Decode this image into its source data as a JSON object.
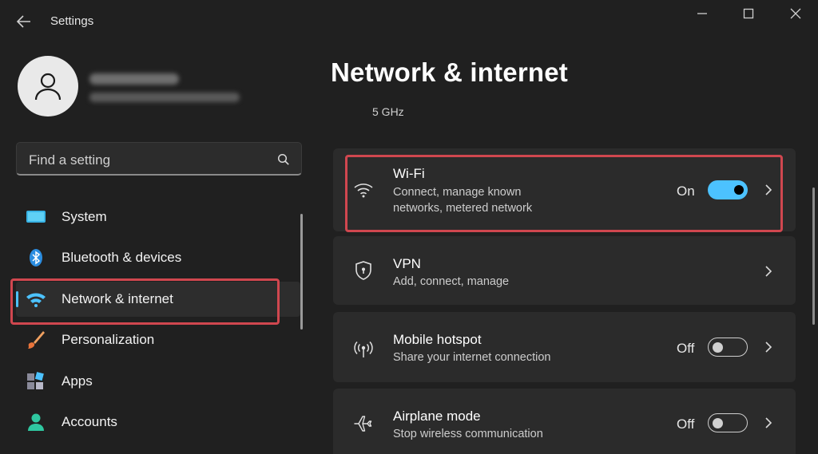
{
  "app": {
    "title": "Settings"
  },
  "account": {
    "name": "",
    "email": ""
  },
  "search": {
    "placeholder": "Find a setting"
  },
  "sidebar": {
    "items": [
      {
        "label": "System"
      },
      {
        "label": "Bluetooth & devices"
      },
      {
        "label": "Network & internet",
        "selected": true
      },
      {
        "label": "Personalization"
      },
      {
        "label": "Apps"
      },
      {
        "label": "Accounts"
      }
    ]
  },
  "page": {
    "title": "Network & internet",
    "subtitle": "5 GHz"
  },
  "cards": [
    {
      "title": "Wi-Fi",
      "desc": "Connect, manage known networks, metered network",
      "state": "On",
      "toggle_on": true,
      "icon": "wifi-icon"
    },
    {
      "title": "VPN",
      "desc": "Add, connect, manage",
      "icon": "shield-icon"
    },
    {
      "title": "Mobile hotspot",
      "desc": "Share your internet connection",
      "state": "Off",
      "toggle_on": false,
      "icon": "hotspot-icon"
    },
    {
      "title": "Airplane mode",
      "desc": "Stop wireless communication",
      "state": "Off",
      "toggle_on": false,
      "icon": "airplane-icon"
    }
  ],
  "colors": {
    "accent": "#4cc2ff",
    "highlight": "#d0474f",
    "background": "#202020",
    "card": "#2b2b2b"
  }
}
